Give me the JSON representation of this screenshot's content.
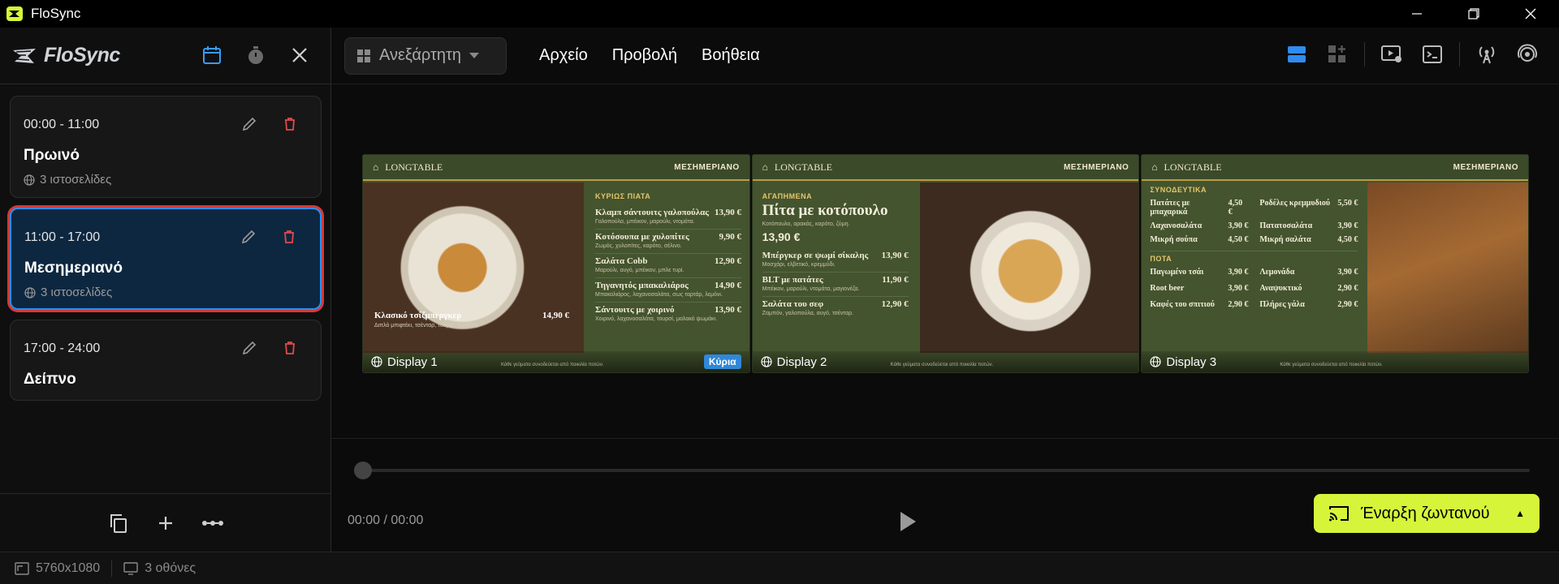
{
  "app": {
    "title": "FloSync",
    "brand": "FloSync"
  },
  "sidebar": {
    "schedules": [
      {
        "time": "00:00 - 11:00",
        "title": "Πρωινό",
        "sub": "3 ιστοσελίδες"
      },
      {
        "time": "11:00 - 17:00",
        "title": "Μεσημεριανό",
        "sub": "3 ιστοσελίδες"
      },
      {
        "time": "17:00 - 24:00",
        "title": "Δείπνο",
        "sub": ""
      }
    ]
  },
  "topbar": {
    "layout_select": "Ανεξάρτητη",
    "menu": [
      "Αρχείο",
      "Προβολή",
      "Βοήθεια"
    ]
  },
  "displays": [
    {
      "name": "Display 1",
      "brand": "LONGTABLE",
      "period": "ΜΕΣΗΜΕΡΙΑΝΟ",
      "badge": "Κύρια",
      "fine": "Κάθε γεύματα συνοδεύεται από ποικιλία ποτών.",
      "caption": {
        "name": "Κλασικό τσίζμπεργκερ",
        "price": "14,90 €",
        "desc": "Διπλό μπιφτέκι, τσένταρ, τουρσί, πατάτες."
      },
      "section": "ΚΥΡΙΩΣ ΠΙΑΤΑ",
      "items": [
        {
          "name": "Κλαμπ σάντουιτς γαλοπούλας",
          "price": "13,90 €",
          "desc": "Γαλοπούλα, μπέικον, μαρούλι, ντομάτα."
        },
        {
          "name": "Κοτόσουπα με χυλοπίτες",
          "price": "9,90 €",
          "desc": "Ζωμός, χυλοπίτες, καρότο, σέλινο."
        },
        {
          "name": "Σαλάτα Cobb",
          "price": "12,90 €",
          "desc": "Μαρούλι, αυγό, μπέικον, μπλε τυρί."
        },
        {
          "name": "Τηγανητός μπακαλιάρος",
          "price": "14,90 €",
          "desc": "Μπακαλιάρος, λαχανοσαλάτα, σως ταρτάρ, λεμόνι."
        },
        {
          "name": "Σάντουιτς με χοιρινό",
          "price": "13,90 €",
          "desc": "Χοιρινό, λαχανοσαλάτα, τουρσί, μαλακό ψωμάκι."
        }
      ]
    },
    {
      "name": "Display 2",
      "brand": "LONGTABLE",
      "period": "ΜΕΣΗΜΕΡΙΑΝΟ",
      "fine": "Κάθε γεύματα συνοδεύεται από ποικιλία ποτών.",
      "fav_label": "ΑΓΑΠΗΜΕΝΑ",
      "fav_title": "Πίτα με κοτόπουλο",
      "fav_desc": "Κοτόπουλο, αρακάς, καρότο, ζύμη.",
      "fav_price": "13,90 €",
      "items": [
        {
          "name": "Μπέργκερ σε ψωμί σίκαλης",
          "price": "13,90 €",
          "desc": "Μοσχάρι, ελβετικό, κρεμμύδι."
        },
        {
          "name": "BLT με πατάτες",
          "price": "11,90 €",
          "desc": "Μπέικον, μαρούλι, ντομάτα, μαγιονέζα."
        },
        {
          "name": "Σαλάτα του σεφ",
          "price": "12,90 €",
          "desc": "Ζαμπόν, γαλοπούλα, αυγό, τσένταρ."
        }
      ]
    },
    {
      "name": "Display 3",
      "brand": "LONGTABLE",
      "period": "ΜΕΣΗΜΕΡΙΑΝΟ",
      "fine": "Κάθε γεύματα συνοδεύεται από ποικιλία ποτών.",
      "sides_label": "ΣΥΝΟΔΕΥΤΙΚΑ",
      "sides": [
        {
          "name": "Πατάτες με μπαχαρικά",
          "price": "4,50 €"
        },
        {
          "name": "Ροδέλες κρεμμυδιού",
          "price": "5,50 €"
        },
        {
          "name": "Λαχανοσαλάτα",
          "price": "3,90 €"
        },
        {
          "name": "Πατατοσαλάτα",
          "price": "3,90 €"
        },
        {
          "name": "Μικρή σούπα",
          "price": "4,50 €"
        },
        {
          "name": "Μικρή σαλάτα",
          "price": "4,50 €"
        }
      ],
      "drinks_label": "ΠΟΤΑ",
      "drinks": [
        {
          "name": "Παγωμένο τσάι",
          "price": "3,90 €"
        },
        {
          "name": "Λεμονάδα",
          "price": "3,90 €"
        },
        {
          "name": "Root beer",
          "price": "3,90 €"
        },
        {
          "name": "Αναψυκτικό",
          "price": "2,90 €"
        },
        {
          "name": "Καφές του σπιτιού",
          "price": "2,90 €"
        },
        {
          "name": "Πλήρες γάλα",
          "price": "2,90 €"
        }
      ]
    }
  ],
  "player": {
    "time": "00:00 / 00:00",
    "progress": 0,
    "live_label": "Έναρξη ζωντανού"
  },
  "status": {
    "resolution": "5760x1080",
    "screens": "3 οθόνες"
  },
  "colors": {
    "accent": "#d6f53a",
    "selection": "#2f8cf0",
    "highlight": "#d23a3a",
    "delete": "#e5484d",
    "board_green": "#44542e"
  },
  "icons": [
    "calendar-icon",
    "timer-icon",
    "close-icon",
    "edit-icon",
    "delete-icon",
    "globe-icon",
    "copy-icon",
    "plus-icon",
    "more-icon",
    "grid-icon",
    "chevron-down-icon",
    "layout-stack-icon",
    "layout-grid-add-icon",
    "preview-settings-icon",
    "terminal-icon",
    "broadcast-icon",
    "cast-icon",
    "play-icon",
    "screen-icon",
    "monitor-icon"
  ]
}
